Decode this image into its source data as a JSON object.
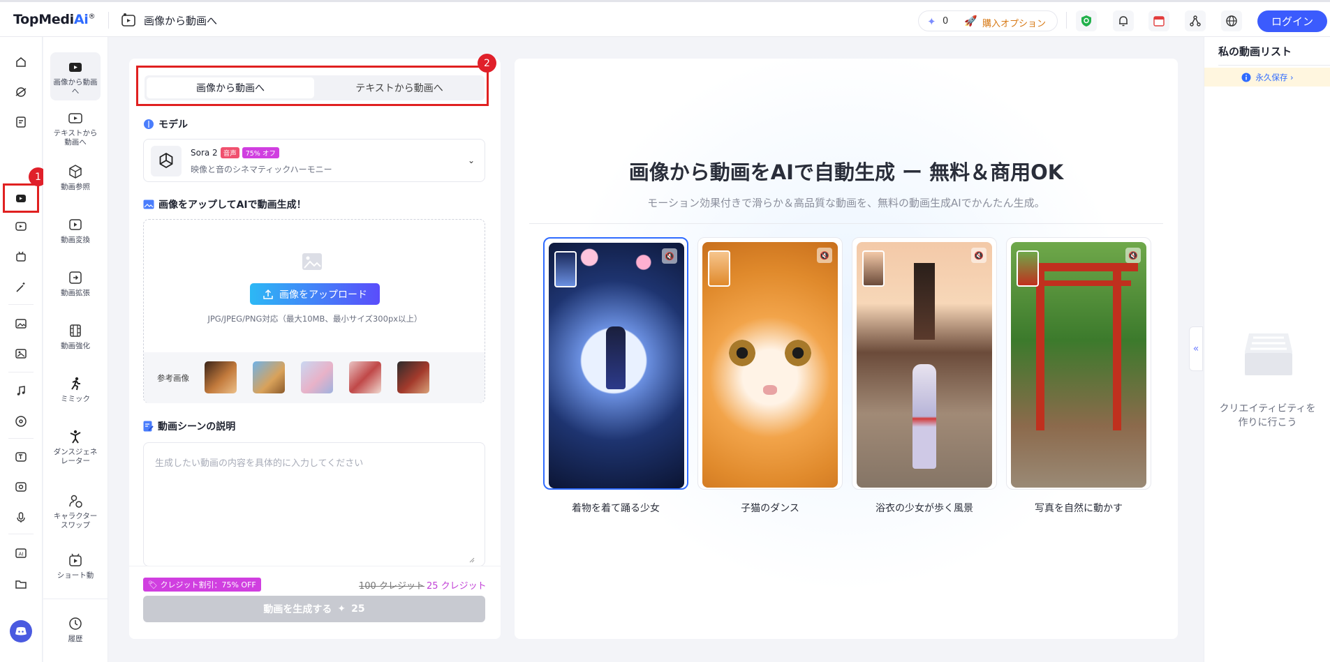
{
  "header": {
    "logo_text": "TopMedi",
    "logo_ai": "Ai",
    "logo_reg": "®",
    "page_title": "画像から動画へ",
    "credits": "0",
    "buy_option": "購入オプション",
    "login": "ログイン"
  },
  "rail": {
    "badge1": "1"
  },
  "subnav": {
    "items": [
      {
        "label": "画像から動画へ"
      },
      {
        "label": "テキストから動画へ"
      },
      {
        "label": "動画参照"
      },
      {
        "label": "動画変換"
      },
      {
        "label": "動画拡張"
      },
      {
        "label": "動画強化"
      },
      {
        "label": "ミミック"
      },
      {
        "label": "ダンスジェネレーター"
      },
      {
        "label": "キャラクタースワップ"
      },
      {
        "label": "ショート動"
      },
      {
        "label": "履歴"
      }
    ]
  },
  "panel": {
    "tabs": [
      "画像から動画へ",
      "テキストから動画へ"
    ],
    "badge2": "2",
    "model_heading": "モデル",
    "model_name": "Sora 2",
    "model_tag_sound": "音声",
    "model_tag_off": "75% オフ",
    "model_desc": "映像と音のシネマティックハーモニー",
    "upload_heading": "画像をアップしてAIで動画生成！",
    "upload_button": "画像をアップロード",
    "upload_hint": "JPG/JPEG/PNG対応（最大10MB、最小サイズ300px以上）",
    "reference_label": "参考画像",
    "desc_heading": "動画シーンの説明",
    "desc_placeholder": "生成したい動画の内容を具体的に入力してください",
    "discount_tag": "クレジット割引：75% OFF",
    "old_price": "100 クレジット",
    "new_price": "25 クレジット",
    "generate_button": "動画を生成する",
    "generate_cost": "25"
  },
  "main": {
    "title": "画像から動画をAIで自動生成 ー 無料＆商用OK",
    "subtitle": "モーション効果付きで滑らか＆高品質な動画を、無料の動画生成AIでかんたん生成。",
    "cards": [
      {
        "label": "着物を着て踊る少女"
      },
      {
        "label": "子猫のダンス"
      },
      {
        "label": "浴衣の少女が歩く風景"
      },
      {
        "label": "写真を自然に動かす"
      }
    ]
  },
  "rightlist": {
    "title": "私の動画リスト",
    "banner": "永久保存 ›",
    "empty_text_1": "クリエイティビティを",
    "empty_text_2": "作りに行こう"
  },
  "colors": {
    "accent": "#3b5bfd",
    "highlight_red": "#e02020",
    "discount": "#d03fe0"
  }
}
